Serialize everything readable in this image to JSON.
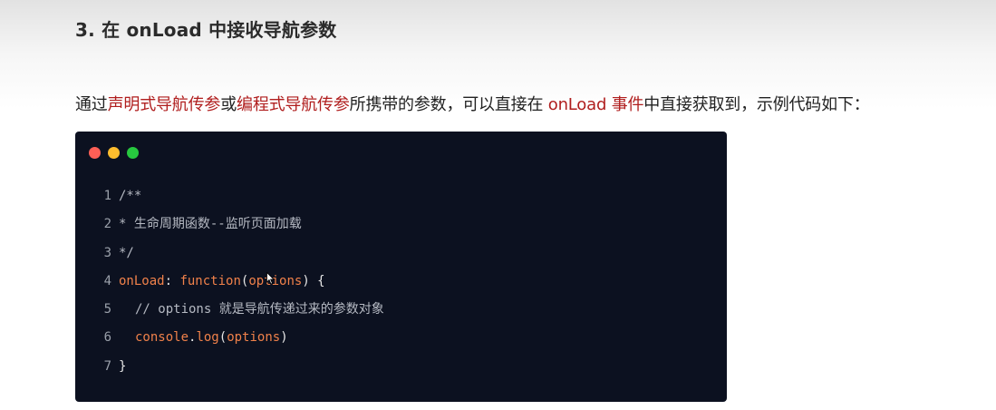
{
  "heading": "3. 在 onLoad 中接收导航参数",
  "paragraph": {
    "part1": "通过",
    "link1": "声明式导航传参",
    "part2": "或",
    "link2": "编程式导航传参",
    "part3": "所携带的参数，可以直接在 ",
    "link3": "onLoad 事件",
    "part4": "中直接获取到，示例代码如下："
  },
  "code": {
    "lines": [
      {
        "num": "1",
        "text": "/**"
      },
      {
        "num": "2",
        "text": "* 生命周期函数--监听页面加载"
      },
      {
        "num": "3",
        "text": "*/"
      },
      {
        "num": "4",
        "func": "onLoad",
        "colon": ": ",
        "kw": "function",
        "open": "(",
        "param": "options",
        "close": ") {"
      },
      {
        "num": "5",
        "text": "// options 就是导航传递过来的参数对象"
      },
      {
        "num": "6",
        "obj": "console",
        "dot": ".",
        "method": "log",
        "open": "(",
        "param": "options",
        "close": ")"
      },
      {
        "num": "7",
        "text": "}"
      }
    ]
  },
  "colors": {
    "code_bg": "#0c1120",
    "highlight_red": "#b01e1e",
    "keyword_orange": "#f0814a"
  }
}
